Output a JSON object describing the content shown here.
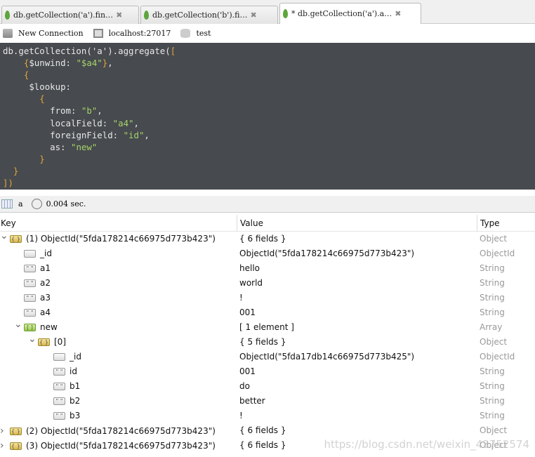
{
  "tabs": [
    {
      "label": "db.getCollection('a').fin…",
      "active": false
    },
    {
      "label": "db.getCollection('b').fi…",
      "active": false
    },
    {
      "label": "* db.getCollection('a').a…",
      "active": true
    }
  ],
  "toolbar": {
    "connection": "New Connection",
    "host": "localhost:27017",
    "database": "test"
  },
  "editor": {
    "lines": [
      [
        [
          "d",
          "db.getCollection('a').aggregate("
        ],
        [
          "o",
          "["
        ]
      ],
      [
        [
          "t",
          "    "
        ],
        [
          "o",
          "{"
        ],
        [
          "d",
          "$unwind: "
        ],
        [
          "s",
          "\"$a4\""
        ],
        [
          "o",
          "}"
        ],
        [
          "d",
          ","
        ]
      ],
      [
        [
          "t",
          "    "
        ],
        [
          "o",
          "{"
        ]
      ],
      [
        [
          "t",
          "     "
        ],
        [
          "d",
          "$lookup:"
        ]
      ],
      [
        [
          "t",
          "       "
        ],
        [
          "o",
          "{"
        ]
      ],
      [
        [
          "t",
          "         "
        ],
        [
          "d",
          "from: "
        ],
        [
          "s",
          "\"b\""
        ],
        [
          "d",
          ","
        ]
      ],
      [
        [
          "t",
          "         "
        ],
        [
          "d",
          "localField: "
        ],
        [
          "s",
          "\"a4\""
        ],
        [
          "d",
          ","
        ]
      ],
      [
        [
          "t",
          "         "
        ],
        [
          "d",
          "foreignField: "
        ],
        [
          "s",
          "\"id\""
        ],
        [
          "d",
          ","
        ]
      ],
      [
        [
          "t",
          "         "
        ],
        [
          "d",
          "as: "
        ],
        [
          "s",
          "\"new\""
        ]
      ],
      [
        [
          "t",
          "       "
        ],
        [
          "o",
          "}"
        ]
      ],
      [
        [
          "t",
          "  "
        ],
        [
          "o",
          "}"
        ]
      ],
      [
        [
          "o",
          "])"
        ]
      ]
    ]
  },
  "result": {
    "collection": "a",
    "time": "0.004 sec."
  },
  "columns": {
    "key": "Key",
    "value": "Value",
    "type": "Type"
  },
  "rows": [
    {
      "depth": 0,
      "arrow": "expanded",
      "icon": "object",
      "key": "(1) ObjectId(\"5fda178214c66975d773b423\")",
      "value": "{ 6 fields }",
      "type": "Object"
    },
    {
      "depth": 1,
      "arrow": "none",
      "icon": "objectid",
      "key": "_id",
      "value": "ObjectId(\"5fda178214c66975d773b423\")",
      "type": "ObjectId"
    },
    {
      "depth": 1,
      "arrow": "none",
      "icon": "string",
      "key": "a1",
      "value": "hello",
      "type": "String"
    },
    {
      "depth": 1,
      "arrow": "none",
      "icon": "string",
      "key": "a2",
      "value": "world",
      "type": "String"
    },
    {
      "depth": 1,
      "arrow": "none",
      "icon": "string",
      "key": "a3",
      "value": "!",
      "type": "String"
    },
    {
      "depth": 1,
      "arrow": "none",
      "icon": "string",
      "key": "a4",
      "value": "001",
      "type": "String"
    },
    {
      "depth": 1,
      "arrow": "expanded",
      "icon": "array",
      "key": "new",
      "value": "[ 1 element ]",
      "type": "Array"
    },
    {
      "depth": 2,
      "arrow": "expanded",
      "icon": "object",
      "key": "[0]",
      "value": "{ 5 fields }",
      "type": "Object"
    },
    {
      "depth": 3,
      "arrow": "none",
      "icon": "objectid",
      "key": "_id",
      "value": "ObjectId(\"5fda17db14c66975d773b425\")",
      "type": "ObjectId"
    },
    {
      "depth": 3,
      "arrow": "none",
      "icon": "string",
      "key": "id",
      "value": "001",
      "type": "String"
    },
    {
      "depth": 3,
      "arrow": "none",
      "icon": "string",
      "key": "b1",
      "value": "do",
      "type": "String"
    },
    {
      "depth": 3,
      "arrow": "none",
      "icon": "string",
      "key": "b2",
      "value": "better",
      "type": "String"
    },
    {
      "depth": 3,
      "arrow": "none",
      "icon": "string",
      "key": "b3",
      "value": "!",
      "type": "String"
    },
    {
      "depth": 0,
      "arrow": "collapsed",
      "icon": "object",
      "key": "(2) ObjectId(\"5fda178214c66975d773b423\")",
      "value": "{ 6 fields }",
      "type": "Object"
    },
    {
      "depth": 0,
      "arrow": "collapsed",
      "icon": "object",
      "key": "(3) ObjectId(\"5fda178214c66975d773b423\")",
      "value": "{ 6 fields }",
      "type": "Object"
    }
  ],
  "watermark": "https://blog.csdn.net/weixin_43752574"
}
